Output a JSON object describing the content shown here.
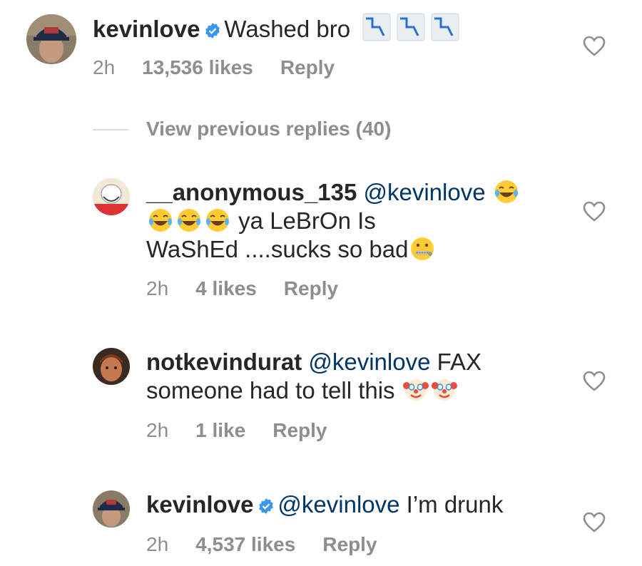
{
  "comments": [
    {
      "username": "kevinlove",
      "verified": true,
      "text": "Washed bro",
      "emojis": [
        "chart-decreasing",
        "chart-decreasing",
        "chart-decreasing"
      ],
      "time": "2h",
      "likes": "13,536 likes",
      "reply": "Reply"
    },
    {
      "username": "__anonymous_135",
      "verified": false,
      "mention": "@kevinlove",
      "text_line2": "ya LeBrOn Is",
      "text_line3": "WaShEd ....sucks so bad",
      "emojis": [
        "tears-of-joy",
        "tears-of-joy",
        "tears-of-joy",
        "tears-of-joy",
        "zipper-mouth"
      ],
      "time": "2h",
      "likes": "4 likes",
      "reply": "Reply"
    },
    {
      "username": "notkevindurat",
      "verified": false,
      "mention": "@kevinlove",
      "text": "FAX",
      "text_line2": "someone had to tell this",
      "emojis": [
        "clown",
        "clown"
      ],
      "time": "2h",
      "likes": "1 like",
      "reply": "Reply"
    },
    {
      "username": "kevinlove",
      "verified": true,
      "mention": "@kevinlove",
      "text": "I’m drunk",
      "time": "2h",
      "likes": "4,537 likes",
      "reply": "Reply"
    }
  ],
  "view_previous": "View previous replies (40)",
  "icons": {
    "like": "heart-outline-icon",
    "verified": "verified-badge-icon"
  },
  "colors": {
    "text": "#262626",
    "meta": "#8e8e8e",
    "mention": "#003569",
    "verified": "#3897f0"
  }
}
